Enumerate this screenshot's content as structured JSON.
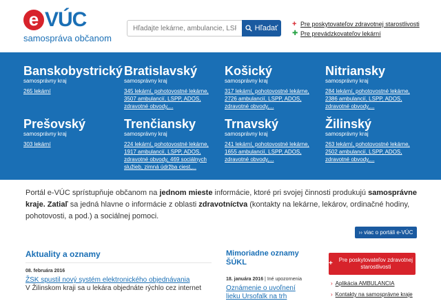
{
  "header": {
    "logo_e": "e",
    "logo_text": "VÚC",
    "logo_sub": "samospráva občanom",
    "search_placeholder": "Hľadajte lekárne, ambulancie, LSPP...",
    "search_button": "Hľadať",
    "provider_link_health": "Pre poskytovateľov zdravotnej starostlivosti",
    "provider_link_pharmacy": "Pre prevádzkovateľov lekární"
  },
  "regions": [
    {
      "name": "Banskobystrický",
      "sub": "samosprávny kraj",
      "links": [
        "265 lekární"
      ]
    },
    {
      "name": "Bratislavský",
      "sub": "samosprávny kraj",
      "links": [
        "345 lekární, pohotovostné lekárne,",
        "3507 ambulancií, LSPP, ADOS,",
        "zdravotné obvody,..."
      ]
    },
    {
      "name": "Košický",
      "sub": "samosprávny kraj",
      "links": [
        "317 lekární, pohotovostné lekárne,",
        "2726 ambulancií, LSPP, ADOS,",
        "zdravotné obvody,..."
      ]
    },
    {
      "name": "Nitriansky",
      "sub": "samosprávny kraj",
      "links": [
        "284 lekární, pohotovostné lekárne,",
        "2386 ambulancií, LSPP, ADOS,",
        "zdravotné obvody,..."
      ]
    },
    {
      "name": "Prešovský",
      "sub": "samosprávny kraj",
      "links": [
        "303 lekární"
      ]
    },
    {
      "name": "Trenčiansky",
      "sub": "samosprávny kraj",
      "links": [
        "224 lekární, pohotovostné lekárne,",
        "1917 ambulancií, LSPP, ADOS,",
        "zdravotné obvody, 469 sociálnych",
        "služieb, zimná údržba ciest,..."
      ]
    },
    {
      "name": "Trnavský",
      "sub": "samosprávny kraj",
      "links": [
        "241 lekární, pohotovostné lekárne,",
        "1655 ambulancií, LSPP, ADOS,",
        "zdravotné obvody,..."
      ]
    },
    {
      "name": "Žilinský",
      "sub": "samosprávny kraj",
      "links": [
        "263 lekární, pohotovostné lekárne,",
        "2502 ambulancií, LSPP, ADOS,",
        "zdravotné obvody,..."
      ]
    }
  ],
  "intro": {
    "p1": "Portál e-VÚC sprístupňuje občanom na ",
    "b1": "jednom mieste",
    "p2": " informácie, ktoré pri svojej činnosti produkujú ",
    "b2": "samosprávne kraje. Zatiaľ",
    "p3": " sa jedná hlavne o informácie z oblasti ",
    "b3": "zdravotníctva",
    "p4": " (kontakty na lekárne, lekárov, ordinačné hodiny, pohotovosti, a pod.) a sociálnej pomoci.",
    "more_button": "›› viac o portáli e-VÚC"
  },
  "news": {
    "title": "Aktuality a oznamy",
    "date": "08. februára 2016",
    "link": "ŽSK spustil nový systém elektronického objednávania",
    "text": "V Žilinskom kraji sa u lekára objednáte rýchlo cez internet"
  },
  "sukl": {
    "title": "Mimoriadne oznamy ŠÚKL",
    "date": "18. januára 2016",
    "separator": " | ",
    "category": "Iné upozornenia",
    "link": "Oznámenie o uvoľnení lieku Ursofalk na trh"
  },
  "sidebar": {
    "cta_plus": "+",
    "cta": "Pre poskytovateľov zdravotnej starostlivosti",
    "link1": "Aplikácia AMBULANCIA",
    "link2": "Kontakty na samosprávne kraje"
  },
  "colors": {
    "brand_blue": "#1a6fb5",
    "brand_red": "#d7232b",
    "button_blue": "#1a5aa0"
  }
}
